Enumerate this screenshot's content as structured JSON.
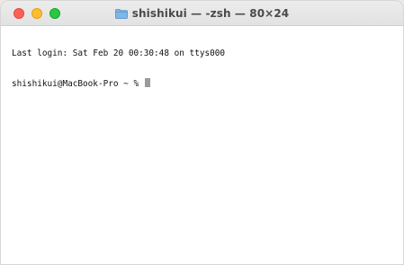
{
  "window": {
    "title": "shishikui — -zsh — 80×24"
  },
  "icons": {
    "title_icon": "folder-icon"
  },
  "colors": {
    "close": "#ff5f57",
    "minimize": "#febc2e",
    "zoom": "#28c840",
    "cursor": "#9a9a9a"
  },
  "terminal": {
    "lines": [
      "Last login: Sat Feb 20 00:30:48 on ttys000",
      "shishikui@MacBook-Pro ~ % "
    ]
  }
}
